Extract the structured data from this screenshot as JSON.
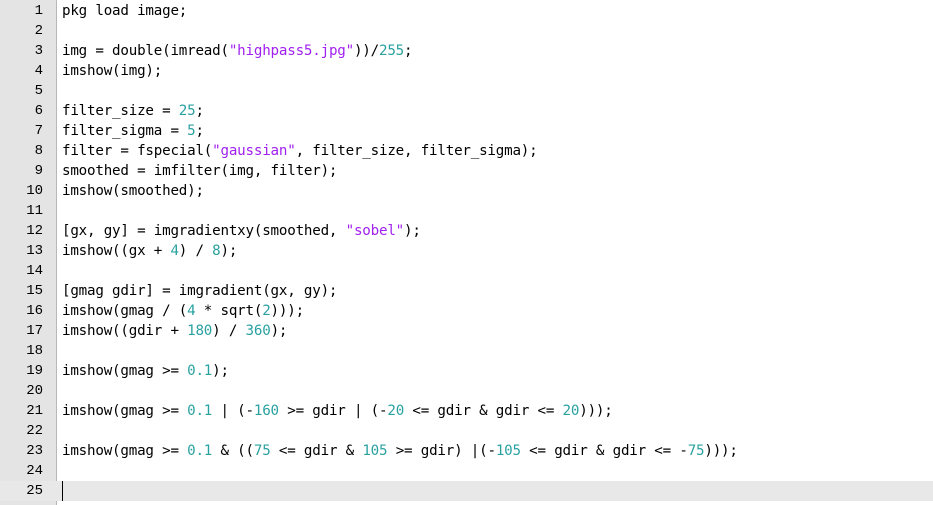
{
  "editor": {
    "current_line": 25,
    "colors": {
      "string": "#a020f0",
      "number": "#2aa1a1",
      "gutter": "#e4e4e4",
      "current_line_bg": "#e8e8e8"
    },
    "lines": [
      {
        "n": "1",
        "tokens": [
          [
            "t",
            "pkg load image;"
          ]
        ]
      },
      {
        "n": "2",
        "tokens": []
      },
      {
        "n": "3",
        "tokens": [
          [
            "t",
            "img = double(imread("
          ],
          [
            "s",
            "\"highpass5.jpg\""
          ],
          [
            "t",
            "))/"
          ],
          [
            "d",
            "255"
          ],
          [
            "t",
            ";"
          ]
        ]
      },
      {
        "n": "4",
        "tokens": [
          [
            "t",
            "imshow(img);"
          ]
        ]
      },
      {
        "n": "5",
        "tokens": []
      },
      {
        "n": "6",
        "tokens": [
          [
            "t",
            "filter_size = "
          ],
          [
            "d",
            "25"
          ],
          [
            "t",
            ";"
          ]
        ]
      },
      {
        "n": "7",
        "tokens": [
          [
            "t",
            "filter_sigma = "
          ],
          [
            "d",
            "5"
          ],
          [
            "t",
            ";"
          ]
        ]
      },
      {
        "n": "8",
        "tokens": [
          [
            "t",
            "filter = fspecial("
          ],
          [
            "s",
            "\"gaussian\""
          ],
          [
            "t",
            ", filter_size, filter_sigma);"
          ]
        ]
      },
      {
        "n": "9",
        "tokens": [
          [
            "t",
            "smoothed = imfilter(img, filter);"
          ]
        ]
      },
      {
        "n": "10",
        "tokens": [
          [
            "t",
            "imshow(smoothed);"
          ]
        ]
      },
      {
        "n": "11",
        "tokens": []
      },
      {
        "n": "12",
        "tokens": [
          [
            "t",
            "[gx, gy] = imgradientxy(smoothed, "
          ],
          [
            "s",
            "\"sobel\""
          ],
          [
            "t",
            ");"
          ]
        ]
      },
      {
        "n": "13",
        "tokens": [
          [
            "t",
            "imshow((gx + "
          ],
          [
            "d",
            "4"
          ],
          [
            "t",
            ") / "
          ],
          [
            "d",
            "8"
          ],
          [
            "t",
            ");"
          ]
        ]
      },
      {
        "n": "14",
        "tokens": []
      },
      {
        "n": "15",
        "tokens": [
          [
            "t",
            "[gmag gdir] = imgradient(gx, gy);"
          ]
        ]
      },
      {
        "n": "16",
        "tokens": [
          [
            "t",
            "imshow(gmag / ("
          ],
          [
            "d",
            "4"
          ],
          [
            "t",
            " * sqrt("
          ],
          [
            "d",
            "2"
          ],
          [
            "t",
            ")));"
          ]
        ]
      },
      {
        "n": "17",
        "tokens": [
          [
            "t",
            "imshow((gdir + "
          ],
          [
            "d",
            "180"
          ],
          [
            "t",
            ") / "
          ],
          [
            "d",
            "360"
          ],
          [
            "t",
            ");"
          ]
        ]
      },
      {
        "n": "18",
        "tokens": []
      },
      {
        "n": "19",
        "tokens": [
          [
            "t",
            "imshow(gmag >= "
          ],
          [
            "d",
            "0.1"
          ],
          [
            "t",
            ");"
          ]
        ]
      },
      {
        "n": "20",
        "tokens": []
      },
      {
        "n": "21",
        "tokens": [
          [
            "t",
            "imshow(gmag >= "
          ],
          [
            "d",
            "0.1"
          ],
          [
            "t",
            " | (-"
          ],
          [
            "d",
            "160"
          ],
          [
            "t",
            " >= gdir | (-"
          ],
          [
            "d",
            "20"
          ],
          [
            "t",
            " <= gdir & gdir <= "
          ],
          [
            "d",
            "20"
          ],
          [
            "t",
            ")));"
          ]
        ]
      },
      {
        "n": "22",
        "tokens": []
      },
      {
        "n": "23",
        "tokens": [
          [
            "t",
            "imshow(gmag >= "
          ],
          [
            "d",
            "0.1"
          ],
          [
            "t",
            " & (("
          ],
          [
            "d",
            "75"
          ],
          [
            "t",
            " <= gdir & "
          ],
          [
            "d",
            "105"
          ],
          [
            "t",
            " >= gdir) |(-"
          ],
          [
            "d",
            "105"
          ],
          [
            "t",
            " <= gdir & gdir <= -"
          ],
          [
            "d",
            "75"
          ],
          [
            "t",
            ")));"
          ]
        ]
      },
      {
        "n": "24",
        "tokens": []
      },
      {
        "n": "25",
        "tokens": []
      }
    ]
  }
}
